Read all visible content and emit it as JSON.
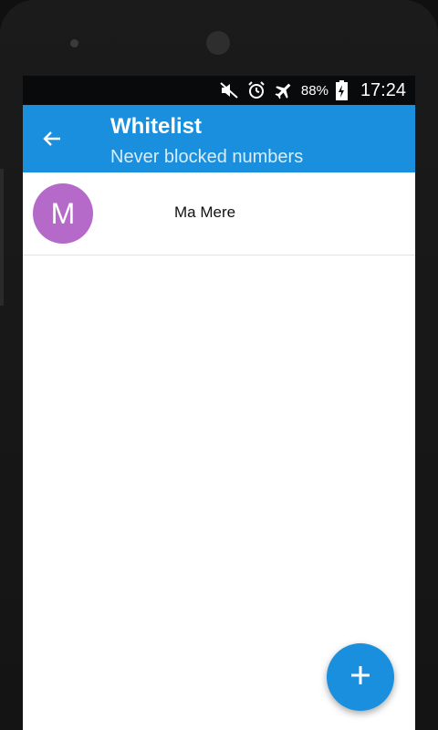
{
  "status_bar": {
    "icons": [
      "mute-icon",
      "alarm-icon",
      "airplane-mode-icon",
      "battery-charging-icon"
    ],
    "battery_percent": "88%",
    "time": "17:24"
  },
  "app_bar": {
    "back_icon": "arrow-back-icon",
    "title": "Whitelist",
    "subtitle": "Never blocked numbers",
    "color": "#1a8fdd"
  },
  "contacts": [
    {
      "initial": "M",
      "name": "Ma Mere",
      "avatar_color": "#b569c8"
    }
  ],
  "fab": {
    "icon": "plus-icon",
    "color": "#1a8fdd"
  }
}
